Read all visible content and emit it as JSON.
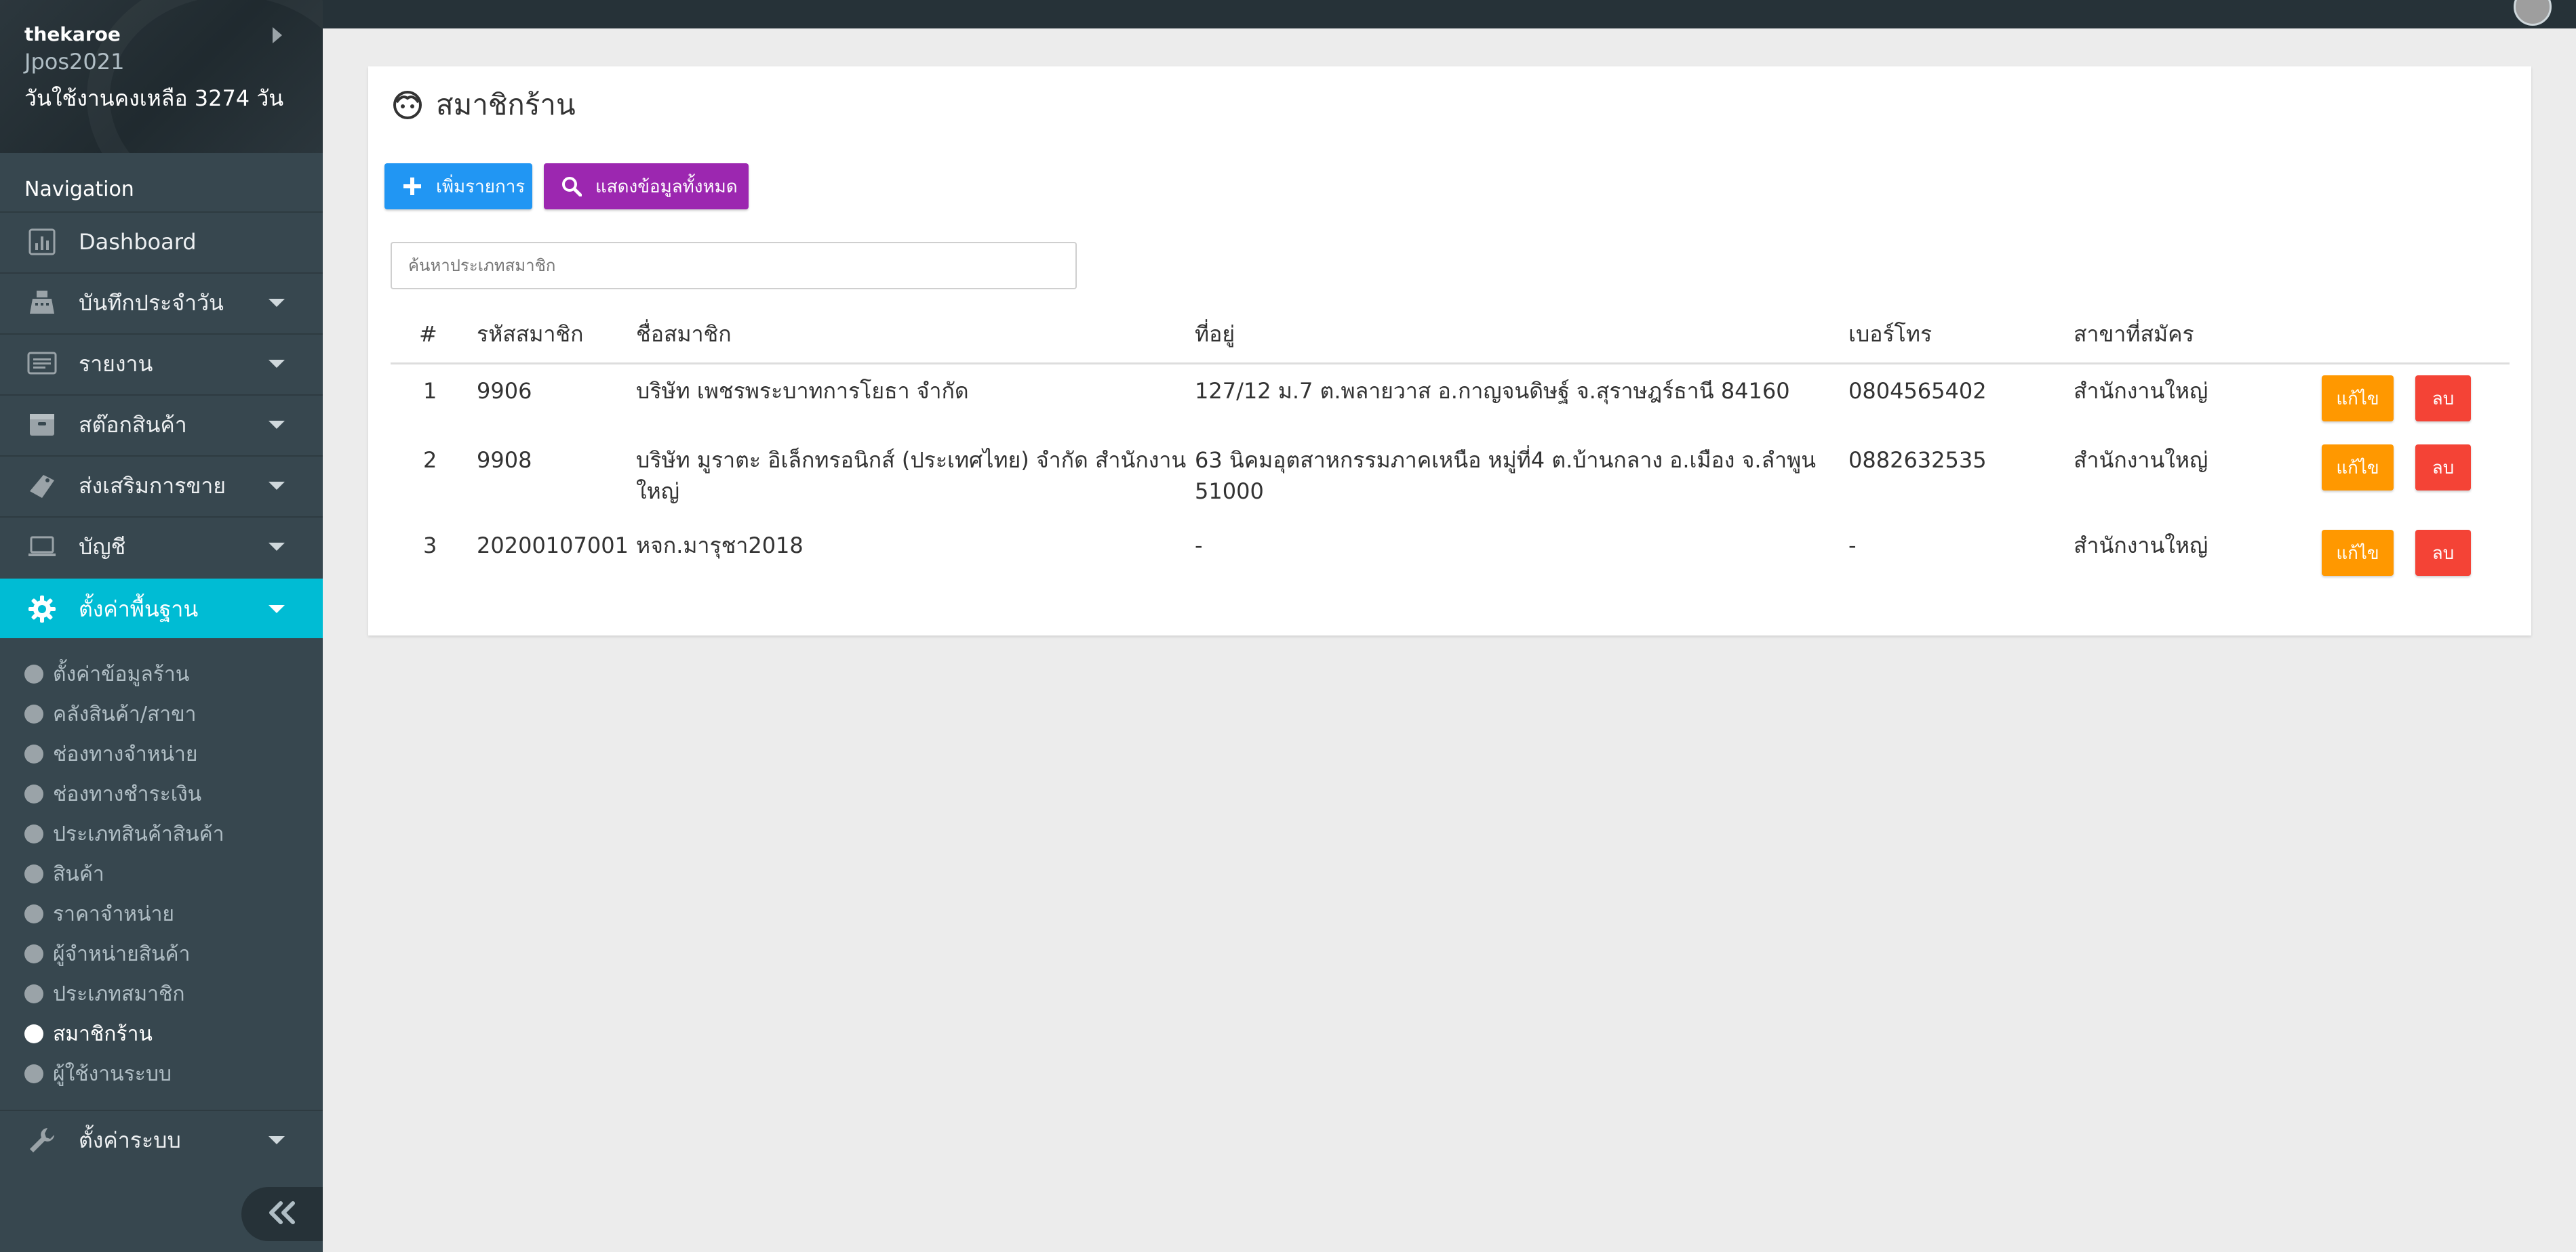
{
  "sidebar": {
    "profile": {
      "username": "thekaroe",
      "shop": "Jpos2021",
      "remaining": "วันใช้งานคงเหลือ 3274 วัน"
    },
    "nav_title": "Navigation",
    "items": [
      {
        "label": "Dashboard",
        "icon": "dashboard-icon"
      },
      {
        "label": "บันทึกประจำวัน",
        "icon": "cash-register-icon"
      },
      {
        "label": "รายงาน",
        "icon": "report-icon"
      },
      {
        "label": "สต๊อกสินค้า",
        "icon": "stock-box-icon"
      },
      {
        "label": "ส่งเสริมการขาย",
        "icon": "promotion-tag-icon"
      },
      {
        "label": "บัญชี",
        "icon": "laptop-icon"
      },
      {
        "label": "ตั้งค่าพื้นฐาน",
        "icon": "gear-icon"
      },
      {
        "label": "ตั้งค่าระบบ",
        "icon": "wrench-icon"
      }
    ],
    "sub_items": [
      "ตั้งค่าข้อมูลร้าน",
      "คลังสินค้า/สาขา",
      "ช่องทางจำหน่าย",
      "ช่องทางชำระเงิน",
      "ประเภทสินค้าสินค้า",
      "สินค้า",
      "ราคาจำหน่าย",
      "ผู้จำหน่ายสินค้า",
      "ประเภทสมาชิก",
      "สมาชิกร้าน",
      "ผู้ใช้งานระบบ"
    ],
    "active_item": "ตั้งค่าพื้นฐาน",
    "current_sub": "สมาชิกร้าน"
  },
  "main": {
    "title": "สมาชิกร้าน",
    "add_button": "เพิ่มรายการ",
    "show_all_button": "แสดงข้อมูลทั้งหมด",
    "search_placeholder": "ค้นหาประเภทสมาชิก",
    "columns": [
      "#",
      "รหัสสมาชิก",
      "ชื่อสมาชิก",
      "ที่อยู่",
      "เบอร์โทร",
      "สาขาที่สมัคร"
    ],
    "rows": [
      {
        "no": "1",
        "code": "9906",
        "name": "บริษัท เพชรพระบาทการโยธา จำกัด",
        "address": "127/12 ม.7 ต.พลายวาส อ.กาญจนดิษฐ์ จ.สุราษฎร์ธานี 84160",
        "phone": "0804565402",
        "branch": "สำนักงานใหญ่"
      },
      {
        "no": "2",
        "code": "9908",
        "name_line1": "บริษัท มูราตะ อิเล็กทรอนิกส์ (ประเทศไทย) จำกัด สำนักงาน",
        "name_line2": "ใหญ่",
        "address_line1": "63 นิคมอุตสาหกรรมภาคเหนือ หมู่ที่4 ต.บ้านกลาง อ.เมือง จ.ลำพูน",
        "address_line2": "51000",
        "phone": "0882632535",
        "branch": "สำนักงานใหญ่"
      },
      {
        "no": "3",
        "code": "20200107001",
        "name": "หจก.มารุชา2018",
        "address": "-",
        "phone": "-",
        "branch": "สำนักงานใหญ่"
      }
    ],
    "edit_label": "แก้ไข",
    "delete_label": "ลบ"
  },
  "colors": {
    "sidebar_bg": "#37474f",
    "topbar_bg": "#263238",
    "active_nav": "#00bcd4",
    "add_button": "#2196f3",
    "show_all_button": "#9c27b0",
    "edit_button": "#ff9800",
    "delete_button": "#f44336"
  }
}
